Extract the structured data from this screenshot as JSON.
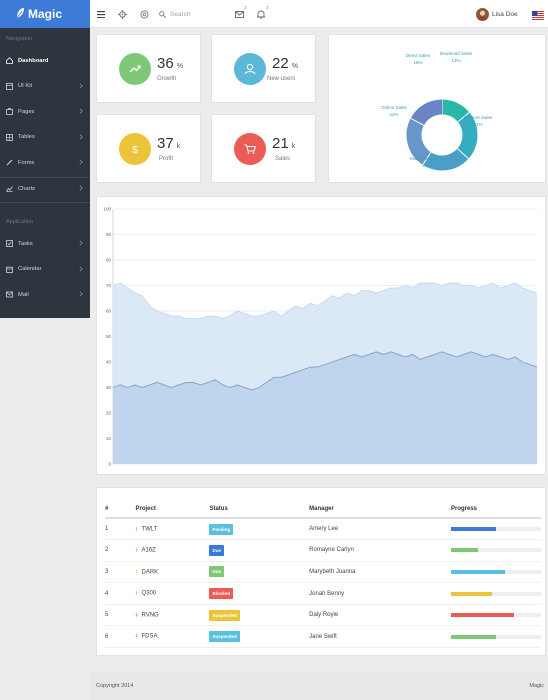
{
  "brand": {
    "name": "Magic"
  },
  "sidebar": {
    "heading_nav": "Navigation",
    "items": [
      {
        "label": "Dashboard",
        "icon": "home-icon",
        "active": true
      },
      {
        "label": "UI Kit",
        "icon": "uikit-icon"
      },
      {
        "label": "Pages",
        "icon": "pages-icon"
      },
      {
        "label": "Tables",
        "icon": "table-icon"
      },
      {
        "label": "Forms",
        "icon": "pencil-icon"
      },
      {
        "label": "Charts",
        "icon": "chart-icon"
      }
    ],
    "heading_app": "Application",
    "app_items": [
      {
        "label": "Tasks",
        "icon": "tasks-icon"
      },
      {
        "label": "Calendar",
        "icon": "calendar-icon"
      },
      {
        "label": "Mail",
        "icon": "mail-icon"
      }
    ]
  },
  "topbar": {
    "search_placeholder": "Search",
    "mail_count": "3",
    "notif_count": "3",
    "user_name": "Lisa Doe",
    "flag": "us-flag-icon"
  },
  "stats": [
    {
      "value": "36",
      "unit": "%",
      "label": "Growth",
      "color": "#7fc87a",
      "icon": "trend-icon"
    },
    {
      "value": "22",
      "unit": "%",
      "label": "New users",
      "color": "#5bb8d6",
      "icon": "user-icon"
    },
    {
      "value": "37",
      "unit": "k",
      "label": "Profit",
      "color": "#ecc43a",
      "icon": "dollar-icon"
    },
    {
      "value": "21",
      "unit": "k",
      "label": "Sales",
      "color": "#ec5b55",
      "icon": "cart-icon"
    }
  ],
  "donut": {
    "slices": [
      {
        "name": "Download Sales",
        "pct": "13%",
        "value": 13,
        "color": "#2bb7a8"
      },
      {
        "name": "In-Store Sales",
        "pct": "21%",
        "value": 21,
        "color": "#35adc0"
      },
      {
        "name": "Mail-Order Sales",
        "pct": "21%",
        "value": 21,
        "color": "#4a9fc8"
      },
      {
        "name": "Online Sales",
        "pct": "22%",
        "value": 22,
        "color": "#6797c8"
      },
      {
        "name": "Direct Sales",
        "pct": "16%",
        "value": 16,
        "color": "#6a85c6"
      }
    ]
  },
  "chart_data": {
    "type": "area",
    "ylim": [
      0,
      100
    ],
    "yticks": [
      "0",
      "10",
      "20",
      "30",
      "40",
      "50",
      "60",
      "70",
      "80",
      "90",
      "100"
    ],
    "series": [
      {
        "values": [
          70,
          71,
          69,
          67,
          66,
          62,
          60,
          59,
          58,
          58,
          57,
          57,
          57,
          58,
          58,
          57,
          58,
          60,
          59,
          58,
          58,
          59,
          60,
          58,
          60,
          62,
          61,
          63,
          62,
          64,
          66,
          65,
          67,
          66,
          68,
          68,
          67,
          68,
          69,
          69,
          70,
          69,
          71,
          71,
          71,
          70,
          71,
          71,
          70,
          70,
          69,
          70,
          71,
          69,
          70,
          71,
          69,
          68,
          67
        ],
        "color": "#dbe9f6"
      },
      {
        "values": [
          30,
          31,
          30,
          31,
          30,
          31,
          32,
          31,
          30,
          31,
          32,
          32,
          31,
          32,
          33,
          31,
          30,
          31,
          30,
          29,
          30,
          32,
          34,
          34,
          35,
          36,
          37,
          38,
          38,
          39,
          40,
          41,
          42,
          43,
          42,
          43,
          44,
          43,
          44,
          43,
          42,
          43,
          41,
          42,
          43,
          44,
          43,
          42,
          43,
          44,
          43,
          42,
          43,
          42,
          41,
          42,
          40,
          39,
          38
        ],
        "color": "#bfd5ee"
      }
    ]
  },
  "table": {
    "headers": [
      "#",
      "Project",
      "Status",
      "Manager",
      "Progress"
    ],
    "rows": [
      {
        "num": "1",
        "project": "TWLT",
        "status": "Pending",
        "status_color": "#5bc0de",
        "manager": "Amery Lee",
        "progress": 0.5,
        "bar_color": "#3b7bd8",
        "icon_color": "#7fc87a"
      },
      {
        "num": "2",
        "project": "A16Z",
        "status": "Due",
        "status_color": "#3b7bd8",
        "manager": "Romayne Carlyn",
        "progress": 0.3,
        "bar_color": "#7fc87a",
        "icon_color": "#7fc87a"
      },
      {
        "num": "3",
        "project": "DARK",
        "status": "Due",
        "status_color": "#7fc87a",
        "manager": "Marybeth Joanna",
        "progress": 0.6,
        "bar_color": "#5bc0de",
        "icon_color": "#ecc43a"
      },
      {
        "num": "4",
        "project": "Q300",
        "status": "Blocked",
        "status_color": "#ec5b55",
        "manager": "Jonah Benny",
        "progress": 0.45,
        "bar_color": "#ecc43a",
        "icon_color": "#7fc87a"
      },
      {
        "num": "5",
        "project": "RVNG",
        "status": "Suspended",
        "status_color": "#ecc43a",
        "manager": "Daly Royle",
        "progress": 0.7,
        "bar_color": "#ec5b55",
        "icon_color": "#ec5b55"
      },
      {
        "num": "6",
        "project": "FDSA",
        "status": "Suspended",
        "status_color": "#5bc0de",
        "manager": "Jane Swift",
        "progress": 0.5,
        "bar_color": "#7fc87a",
        "icon_color": "#ec5b55"
      }
    ]
  },
  "footer": {
    "copyright": "Copyright 2014",
    "brand": "Magic"
  }
}
